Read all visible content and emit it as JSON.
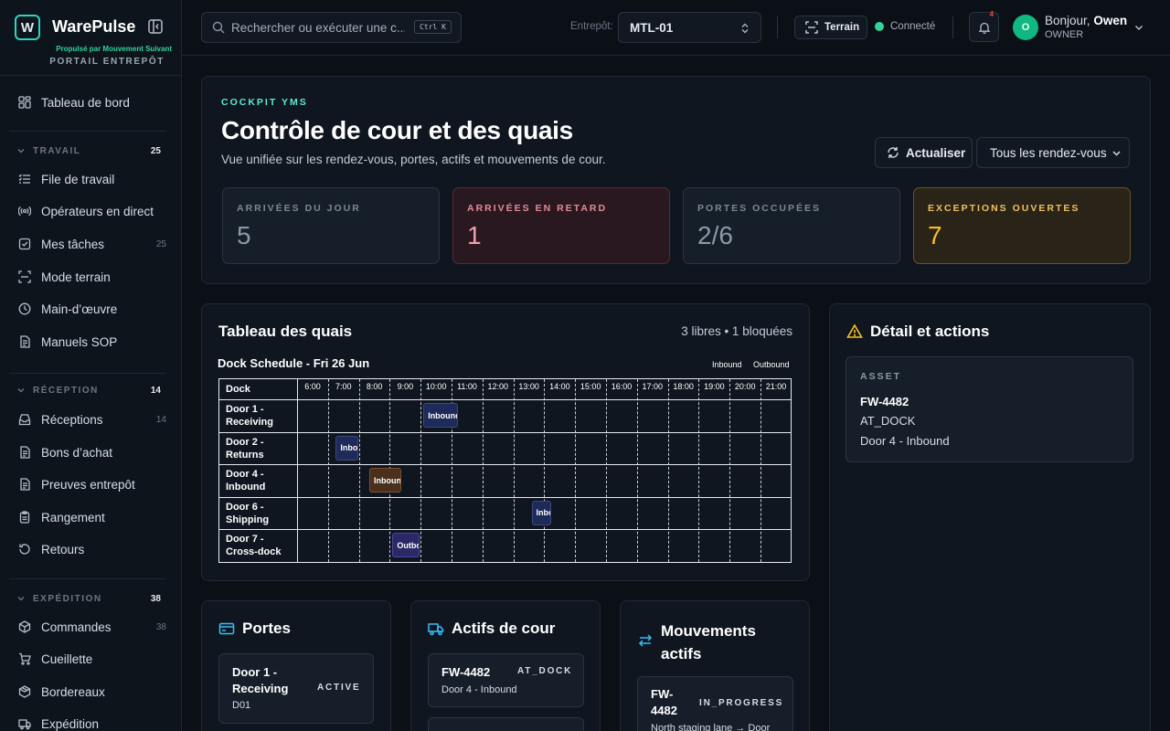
{
  "brand": {
    "logo_letter": "W",
    "name": "WarePulse",
    "powered_by": "Propulsé par Mouvement Suivant",
    "portal": "PORTAIL ENTREPÔT"
  },
  "sidebar": {
    "dashboard": "Tableau de bord",
    "sections": [
      {
        "title": "TRAVAIL",
        "count": "25",
        "items": [
          {
            "label": "File de travail",
            "icon": "list-icon"
          },
          {
            "label": "Opérateurs en direct",
            "icon": "radio-icon"
          },
          {
            "label": "Mes tâches",
            "icon": "check-square-icon",
            "count": "25"
          },
          {
            "label": "Mode terrain",
            "icon": "terrain-icon"
          },
          {
            "label": "Main-d’œuvre",
            "icon": "clock-icon"
          },
          {
            "label": "Manuels SOP",
            "icon": "document-icon"
          }
        ]
      },
      {
        "title": "RÉCEPTION",
        "count": "14",
        "items": [
          {
            "label": "Réceptions",
            "icon": "inbox-icon",
            "count": "14"
          },
          {
            "label": "Bons d’achat",
            "icon": "document-icon"
          },
          {
            "label": "Preuves entrepôt",
            "icon": "document-icon"
          },
          {
            "label": "Rangement",
            "icon": "clipboard-icon"
          },
          {
            "label": "Retours",
            "icon": "rotate-icon"
          }
        ]
      },
      {
        "title": "EXPÉDITION",
        "count": "38",
        "items": [
          {
            "label": "Commandes",
            "icon": "package-icon",
            "count": "38"
          },
          {
            "label": "Cueillette",
            "icon": "cart-icon"
          },
          {
            "label": "Bordereaux",
            "icon": "box-icon"
          },
          {
            "label": "Expédition",
            "icon": "truck-icon"
          }
        ]
      }
    ]
  },
  "topbar": {
    "search_placeholder": "Rechercher ou exécuter une c...",
    "shortcut": "Ctrl K",
    "warehouse_label": "Entrepôt:",
    "warehouse_value": "MTL-01",
    "terrain_label": "Terrain",
    "connection_status": "Connecté",
    "notification_count": "4",
    "avatar_letter": "O",
    "greeting": "Bonjour,",
    "user_name": "Owen",
    "user_role": "OWNER"
  },
  "hero": {
    "eyebrow": "COCKPIT YMS",
    "title": "Contrôle de cour et des quais",
    "subtitle": "Vue unifiée sur les rendez-vous, portes, actifs et mouvements de cour.",
    "refresh_label": "Actualiser",
    "filter_value": "Tous les rendez-vous",
    "kpis": [
      {
        "label": "ARRIVÉES DU JOUR",
        "value": "5"
      },
      {
        "label": "ARRIVÉES EN RETARD",
        "value": "1"
      },
      {
        "label": "PORTES OCCUPÉES",
        "value": "2/6"
      },
      {
        "label": "EXCEPTIONS OUVERTES",
        "value": "7"
      }
    ]
  },
  "dock_board": {
    "title": "Tableau des quais",
    "summary": "3 libres • 1 bloquées",
    "schedule_title": "Dock Schedule - Fri 26 Jun",
    "legend": [
      "Inbound",
      "Outbound"
    ],
    "dock_header": "Dock",
    "hours": [
      "6:00",
      "7:00",
      "8:00",
      "9:00",
      "10:00",
      "11:00",
      "12:00",
      "13:00",
      "14:00",
      "15:00",
      "16:00",
      "17:00",
      "18:00",
      "19:00",
      "20:00",
      "21:00"
    ],
    "docks": [
      "Door 1 - Receiving",
      "Door 2 - Returns",
      "Door 4 - Inbound",
      "Door 6 - Shipping",
      "Door 7 - Cross-dock"
    ],
    "appointments": [
      {
        "dock": 0,
        "start": "10:00",
        "end": "11:15",
        "label": "Inbound",
        "kind": "in"
      },
      {
        "dock": 1,
        "start": "7:10",
        "end": "8:00",
        "label": "Inbound",
        "kind": "in"
      },
      {
        "dock": 2,
        "start": "8:15",
        "end": "9:25",
        "label": "Inbound",
        "kind": "in-orange"
      },
      {
        "dock": 3,
        "start": "13:30",
        "end": "14:15",
        "label": "Inbound",
        "kind": "in"
      },
      {
        "dock": 4,
        "start": "9:00",
        "end": "10:00",
        "label": "Outbound",
        "kind": "out"
      }
    ]
  },
  "detail": {
    "title": "Détail et actions",
    "eyebrow": "ASSET",
    "asset_id": "FW-4482",
    "status": "AT_DOCK",
    "location": "Door 4 - Inbound"
  },
  "doors": {
    "title": "Portes",
    "items": [
      {
        "name": "Door 1 - Receiving",
        "code": "D01",
        "status": "ACTIVE"
      }
    ]
  },
  "yard_assets": {
    "title": "Actifs de cour",
    "items": [
      {
        "id": "FW-4482",
        "status": "AT_DOCK",
        "location": "Door 4 - Inbound"
      }
    ]
  },
  "movements": {
    "title": "Mouvements actifs",
    "items": [
      {
        "id": "FW-4482",
        "status": "IN_PROGRESS",
        "route": "North staging lane → Door"
      }
    ]
  }
}
